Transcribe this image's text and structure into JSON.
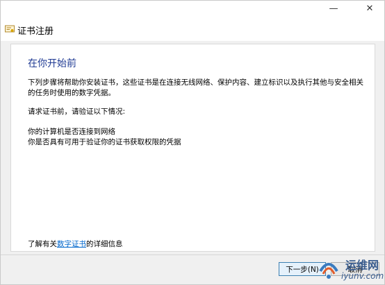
{
  "window": {
    "minimize_glyph": "—",
    "close_glyph": "✕",
    "title": "证书注册",
    "icon": "certificate-icon"
  },
  "content": {
    "heading": "在你开始前",
    "para1": "下列步骤将帮助你安装证书，这些证书是在连接无线网络、保护内容、建立标识以及执行其他与安全相关的任务时使用的数字凭据。",
    "para2": "请求证书前，请验证以下情况:",
    "para3": "你的计算机是否连接到网络",
    "para4": "你是否具有可用于验证你的证书获取权限的凭据",
    "learn_prefix": "了解有关",
    "learn_link": "数字证书",
    "learn_suffix": "的详细信息"
  },
  "buttons": {
    "next": "下一步(N)",
    "cancel": "取消"
  },
  "watermark": {
    "cn": "运维网",
    "en": "iyunv.com"
  },
  "colors": {
    "heading": "#1f3a93",
    "link": "#0066cc"
  }
}
